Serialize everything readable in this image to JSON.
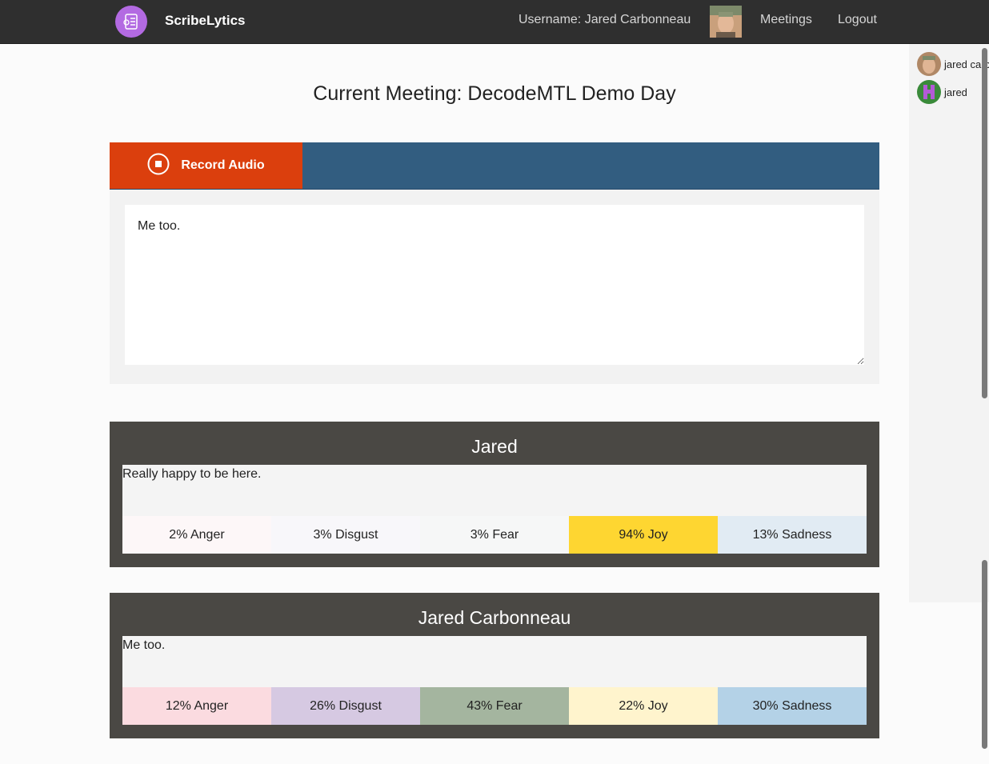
{
  "nav": {
    "brand": "ScribeLytics",
    "username_label": "Username: Jared Carbonneau",
    "links": [
      "Meetings",
      "Logout"
    ]
  },
  "presence": [
    {
      "name": "jared carbonneau"
    },
    {
      "name": "jared"
    }
  ],
  "meeting": {
    "title": "Current Meeting: DecodeMTL Demo Day"
  },
  "recorder": {
    "button_label": "Record Audio",
    "transcript_value": "Me too."
  },
  "cards": [
    {
      "name": "Jared",
      "text": "Really happy to be here.",
      "emotions": [
        {
          "label": "2% Anger",
          "color": "#fdf7f8"
        },
        {
          "label": "3% Disgust",
          "color": "#f8f7fa"
        },
        {
          "label": "3% Fear",
          "color": "#f6f7f7"
        },
        {
          "label": "94% Joy",
          "color": "#fed631"
        },
        {
          "label": "13% Sadness",
          "color": "#e1ebf3"
        }
      ]
    },
    {
      "name": "Jared Carbonneau",
      "text": "Me too.",
      "emotions": [
        {
          "label": "12% Anger",
          "color": "#fbdbe0"
        },
        {
          "label": "26% Disgust",
          "color": "#d6c9e2"
        },
        {
          "label": "43% Fear",
          "color": "#a4b59f"
        },
        {
          "label": "22% Joy",
          "color": "#fff4cd"
        },
        {
          "label": "30% Sadness",
          "color": "#b4d2e7"
        }
      ]
    }
  ]
}
